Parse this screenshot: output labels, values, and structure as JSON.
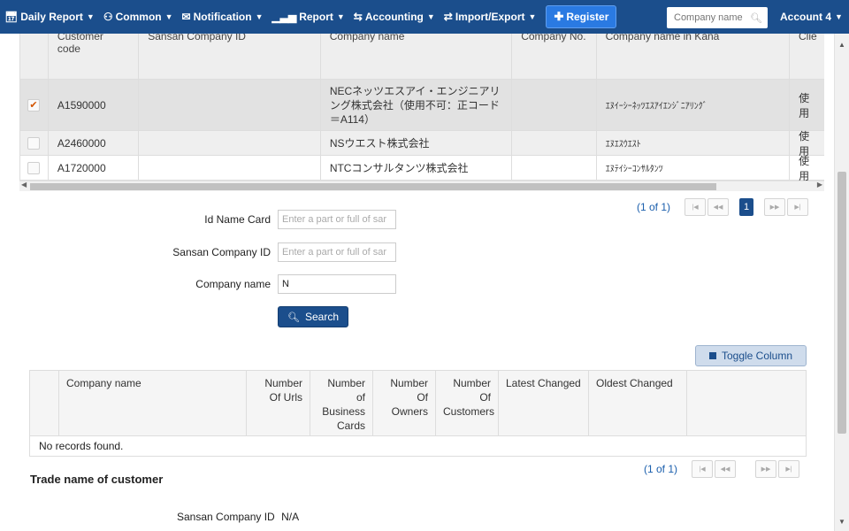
{
  "nav": {
    "items": [
      {
        "label": "Daily Report",
        "icon": "calendar-icon"
      },
      {
        "label": "Common",
        "icon": "users-icon"
      },
      {
        "label": "Notification",
        "icon": "envelope-icon"
      },
      {
        "label": "Report",
        "icon": "bar-chart-icon"
      },
      {
        "label": "Accounting",
        "icon": "exchange-icon"
      },
      {
        "label": "Import/Export",
        "icon": "swap-icon"
      }
    ],
    "register_label": "Register",
    "search_placeholder": "Company name",
    "account_label": "Account 4"
  },
  "upper_table": {
    "headers": [
      "Customer code",
      "Sansan Company ID",
      "Company name",
      "Company No.",
      "Company name in Kana",
      "Clie"
    ],
    "rows": [
      {
        "checked": true,
        "code": "A1590000",
        "sansan_id": "",
        "company": "NECネッツエスアイ・エンジニアリング株式会社（使用不可：正コード＝A114）",
        "company_no": "",
        "kana": "ｴﾇｲｰｼｰﾈｯﾂｴｽｱｲｴﾝｼﾞﾆｱﾘﾝｸﾞ",
        "client": "使用"
      },
      {
        "checked": false,
        "code": "A2460000",
        "sansan_id": "",
        "company": "NSウエスト株式会社",
        "company_no": "",
        "kana": "ｴﾇｴｽｳｴｽﾄ",
        "client": "使用"
      },
      {
        "checked": false,
        "code": "A1720000",
        "sansan_id": "",
        "company": "NTCコンサルタンツ株式会社",
        "company_no": "",
        "kana": "ｴﾇﾃｲｼｰｺﾝｻﾙﾀﾝﾂ",
        "client": "使用"
      }
    ],
    "pager": {
      "info": "(1 of 1)",
      "current_page": "1"
    }
  },
  "form": {
    "id_name_card_label": "Id Name Card",
    "id_name_card_placeholder": "Enter a part or full of sar",
    "sansan_label": "Sansan Company ID",
    "sansan_placeholder": "Enter a part or full of sar",
    "company_label": "Company name",
    "company_value": "N",
    "search_label": "Search"
  },
  "toggle_column_label": "Toggle Column",
  "lower_table": {
    "headers": [
      "Company name",
      "Number Of Urls",
      "Number of Business Cards",
      "Number Of Owners",
      "Number Of Customers",
      "Latest Changed",
      "Oldest Changed"
    ],
    "empty_message": "No records found.",
    "pager": {
      "info": "(1 of 1)"
    }
  },
  "trade_section": {
    "title": "Trade name of customer",
    "sansan_label": "Sansan Company ID",
    "sansan_value": "N/A"
  },
  "colors": {
    "navbar": "#1b4e8c",
    "register": "#2a7ae2",
    "primary": "#1b4e8c"
  }
}
